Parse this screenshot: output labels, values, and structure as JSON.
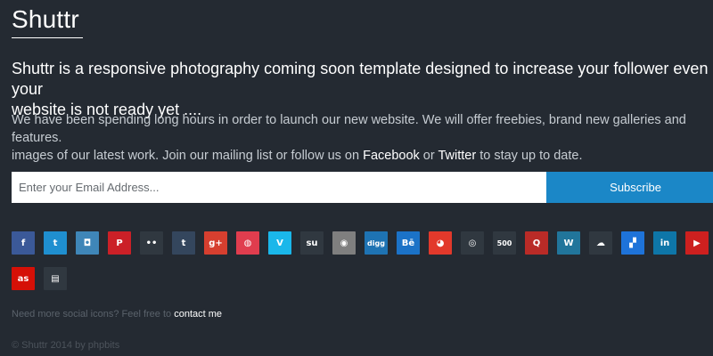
{
  "brand": {
    "name": "Shuttr"
  },
  "headline": "Shuttr is a responsive photography coming soon template designed to increase your follower even if your\nwebsite is not ready yet ....",
  "intro": {
    "line1": "We have been spending long hours in order to launch our new website. We will offer freebies, brand new galleries and features.",
    "line2_start": "images of our latest work. Join our mailing list or follow us on ",
    "facebook": "Facebook",
    "or": " or ",
    "twitter": "Twitter",
    "line2_end": " to stay up to date."
  },
  "subscribe": {
    "placeholder": "Enter your Email Address...",
    "button_label": "Subscribe"
  },
  "social": [
    {
      "name": "facebook",
      "glyph": "f",
      "color": "#3b5998"
    },
    {
      "name": "twitter",
      "glyph": "t",
      "color": "#1f8fd0"
    },
    {
      "name": "instagram",
      "glyph": "◘",
      "color": "#3f86b8"
    },
    {
      "name": "pinterest",
      "glyph": "P",
      "color": "#cb2027"
    },
    {
      "name": "flickr",
      "glyph": "••",
      "color": "#303840"
    },
    {
      "name": "tumblr",
      "glyph": "t",
      "color": "#34465d"
    },
    {
      "name": "google-plus",
      "glyph": "g+",
      "color": "#d63f2f"
    },
    {
      "name": "dribbble",
      "glyph": "◍",
      "color": "#e03d4e"
    },
    {
      "name": "vimeo",
      "glyph": "V",
      "color": "#1ab7ea"
    },
    {
      "name": "stumbleupon",
      "glyph": "su",
      "color": "#303840"
    },
    {
      "name": "forrst",
      "glyph": "◉",
      "color": "#7f7f7f"
    },
    {
      "name": "digg",
      "glyph": "digg",
      "color": "#1e73b3"
    },
    {
      "name": "behance",
      "glyph": "Bē",
      "color": "#1b72c7"
    },
    {
      "name": "reddit",
      "glyph": "◕",
      "color": "#e2392b"
    },
    {
      "name": "path",
      "glyph": "◎",
      "color": "#303840"
    },
    {
      "name": "500px",
      "glyph": "500",
      "color": "#303840"
    },
    {
      "name": "quora",
      "glyph": "Q",
      "color": "#b92b27"
    },
    {
      "name": "wordpress",
      "glyph": "W",
      "color": "#21759b"
    },
    {
      "name": "soundcloud",
      "glyph": "☁",
      "color": "#303840"
    },
    {
      "name": "delicious",
      "glyph": "▞",
      "color": "#1e73d9"
    },
    {
      "name": "linkedin",
      "glyph": "in",
      "color": "#0e76a8"
    },
    {
      "name": "youtube",
      "glyph": "▶",
      "color": "#cd201f"
    },
    {
      "name": "lastfm",
      "glyph": "as",
      "color": "#d51007"
    },
    {
      "name": "myspace",
      "glyph": "▤",
      "color": "#303840"
    }
  ],
  "footer": {
    "note": "Need more social icons? Feel free to ",
    "contact_link": "contact me",
    "copyright": "© Shuttr 2014 by phpbits"
  }
}
